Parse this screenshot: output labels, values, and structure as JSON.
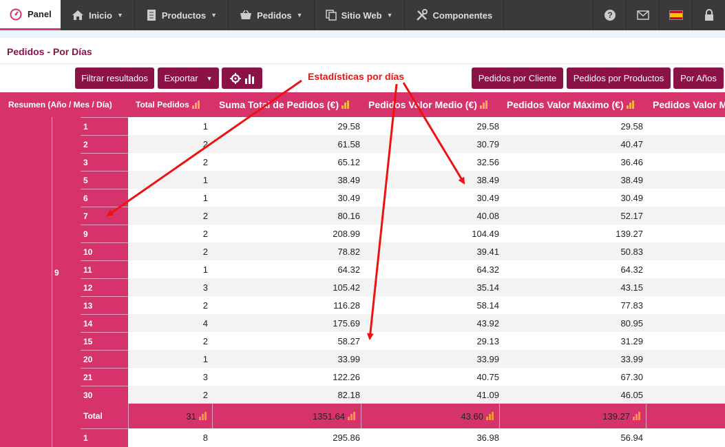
{
  "nav": {
    "panel": "Panel",
    "items": [
      {
        "label": "Inicio",
        "icon": "home-icon"
      },
      {
        "label": "Productos",
        "icon": "book-icon"
      },
      {
        "label": "Pedidos",
        "icon": "basket-icon"
      },
      {
        "label": "Sitio Web",
        "icon": "copy-icon"
      },
      {
        "label": "Componentes",
        "icon": "tools-icon"
      }
    ],
    "right_icons": [
      "help-icon",
      "mail-icon",
      "flag-es-icon",
      "lock-icon"
    ]
  },
  "page": {
    "title": "Pedidos - Por Días"
  },
  "toolbar": {
    "filter": "Filtrar resultados",
    "export": "Exportar",
    "by_client": "Pedidos por Cliente",
    "by_product": "Pedidos por Productos",
    "by_year": "Por Años"
  },
  "annotation": "Estadísticas por días",
  "table": {
    "headers": [
      "Resumen (Año / Mes / Día)",
      "Total Pedidos",
      "Suma Total de Pedidos (€)",
      "Pedidos Valor Medio (€)",
      "Pedidos Valor Máximo (€)",
      "Pedidos Valor M"
    ],
    "month": "9",
    "rows": [
      {
        "day": "1",
        "total": "1",
        "sum": "29.58",
        "avg": "29.58",
        "max": "29.58"
      },
      {
        "day": "2",
        "total": "2",
        "sum": "61.58",
        "avg": "30.79",
        "max": "40.47"
      },
      {
        "day": "3",
        "total": "2",
        "sum": "65.12",
        "avg": "32.56",
        "max": "36.46"
      },
      {
        "day": "5",
        "total": "1",
        "sum": "38.49",
        "avg": "38.49",
        "max": "38.49"
      },
      {
        "day": "6",
        "total": "1",
        "sum": "30.49",
        "avg": "30.49",
        "max": "30.49"
      },
      {
        "day": "7",
        "total": "2",
        "sum": "80.16",
        "avg": "40.08",
        "max": "52.17"
      },
      {
        "day": "9",
        "total": "2",
        "sum": "208.99",
        "avg": "104.49",
        "max": "139.27"
      },
      {
        "day": "10",
        "total": "2",
        "sum": "78.82",
        "avg": "39.41",
        "max": "50.83"
      },
      {
        "day": "11",
        "total": "1",
        "sum": "64.32",
        "avg": "64.32",
        "max": "64.32"
      },
      {
        "day": "12",
        "total": "3",
        "sum": "105.42",
        "avg": "35.14",
        "max": "43.15"
      },
      {
        "day": "13",
        "total": "2",
        "sum": "116.28",
        "avg": "58.14",
        "max": "77.83"
      },
      {
        "day": "14",
        "total": "4",
        "sum": "175.69",
        "avg": "43.92",
        "max": "80.95"
      },
      {
        "day": "15",
        "total": "2",
        "sum": "58.27",
        "avg": "29.13",
        "max": "31.29"
      },
      {
        "day": "20",
        "total": "1",
        "sum": "33.99",
        "avg": "33.99",
        "max": "33.99"
      },
      {
        "day": "21",
        "total": "3",
        "sum": "122.26",
        "avg": "40.75",
        "max": "67.30"
      },
      {
        "day": "30",
        "total": "2",
        "sum": "82.18",
        "avg": "41.09",
        "max": "46.05"
      }
    ],
    "totals": {
      "label": "Total",
      "total": "31",
      "sum": "1351.64",
      "avg": "43.60",
      "max": "139.27"
    },
    "next_row": {
      "day": "1",
      "total": "8",
      "sum": "295.86",
      "avg": "36.98",
      "max": "56.94"
    }
  },
  "colors": {
    "brand": "#8a1246",
    "accent": "#d6336c",
    "nav": "#3a3a3a",
    "annotation": "#ee1111"
  }
}
